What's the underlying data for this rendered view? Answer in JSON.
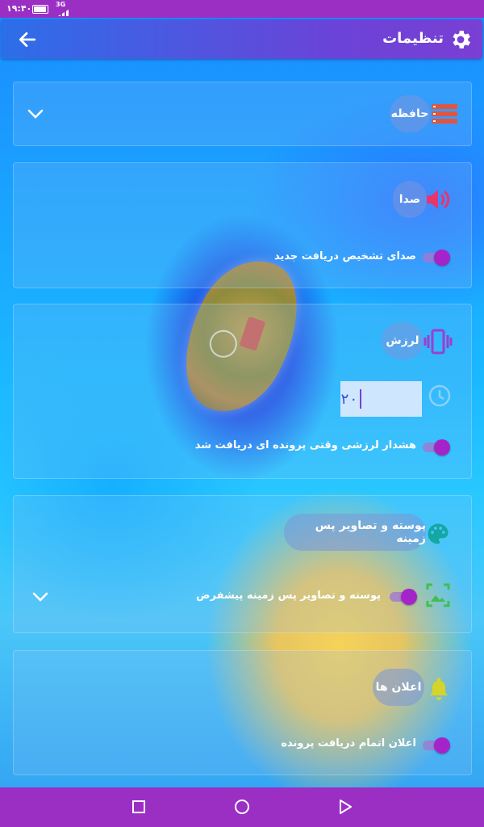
{
  "status_bar": {
    "time": "۱۹:۴۰",
    "network": "3G"
  },
  "header": {
    "title": "تنظیمات"
  },
  "sections": {
    "storage": {
      "title": "حافظه"
    },
    "sound": {
      "title": "صدا",
      "row_label": "صدای تشخیص دریافت جدید"
    },
    "vibration": {
      "title": "لرزش",
      "duration_value": "۲۰",
      "row_label": "هشدار لرزشی وقتی پرونده ای دریافت شد"
    },
    "skins": {
      "title": "پوسته و تصاویر پس زمینه",
      "row_label": "پوسته و تصاویر پس زمینه پیشفرض"
    },
    "notifications": {
      "title": "اعلان ها",
      "row_label": "اعلان اتمام دریافت پرونده"
    }
  },
  "colors": {
    "status_bar": "#9b2fc4",
    "header_start": "#2c6ee9",
    "header_end": "#7a3fd3",
    "toggle_knob": "#a524c9",
    "icon_storage": "#e0553f",
    "icon_sound": "#e8356d",
    "icon_vibration": "#9a3fd0",
    "icon_palette": "#14a7a3",
    "icon_image": "#3fbf52",
    "icon_bell": "#d6d428"
  }
}
